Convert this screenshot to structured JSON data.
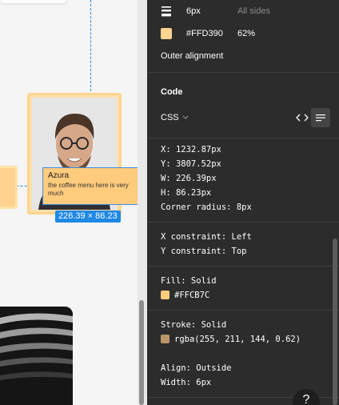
{
  "canvas": {
    "label_card": {
      "title": "Azura",
      "description": "the coffee menu here is very much"
    },
    "dimension_badge": "226.39 × 86.23"
  },
  "stroke_settings": {
    "weight": "6px",
    "sides": "All sides",
    "color_hex": "#FFD390",
    "opacity": "62%",
    "alignment": "Outer alignment",
    "swatch_color": "#FFD390"
  },
  "code": {
    "heading": "Code",
    "language": "CSS",
    "x": "X: 1232.87px",
    "y": "Y: 3807.52px",
    "w": "W: 226.39px",
    "h": "H: 86.23px",
    "corner_radius": "Corner radius: 8px",
    "x_constraint": "X constraint: Left",
    "y_constraint": "Y constraint: Top",
    "fill_label": "Fill: Solid",
    "fill_value": "#FFCB7C",
    "fill_color": "#FFCB7C",
    "stroke_label": "Stroke: Solid",
    "stroke_value": "rgba(255, 211, 144, 0.62)",
    "stroke_color": "#B9976A",
    "align": "Align: Outside",
    "width": "Width: 6px"
  },
  "help_label": "?"
}
